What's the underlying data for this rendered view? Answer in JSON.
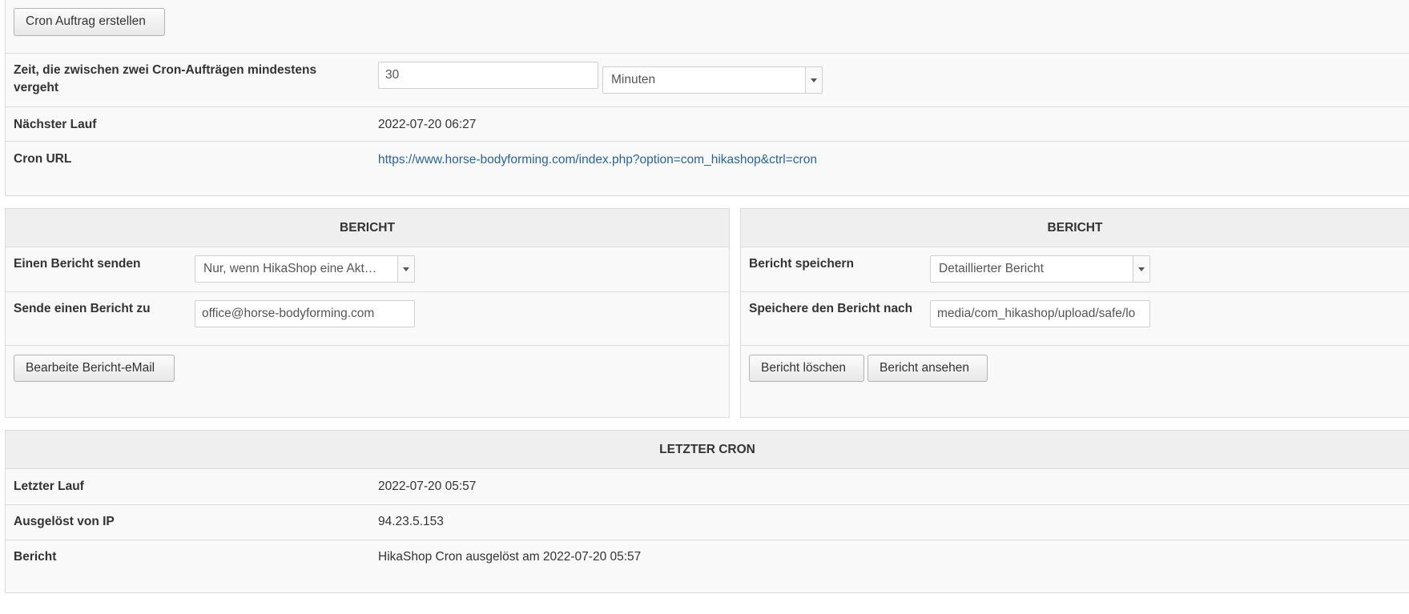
{
  "top": {
    "create_button": "Cron Auftrag erstellen",
    "interval_label": "Zeit, die zwischen zwei Cron-Aufträgen mindestens vergeht",
    "interval_value": "30",
    "interval_unit": "Minuten",
    "next_run_label": "Nächster Lauf",
    "next_run_value": "2022-07-20 06:27",
    "cron_url_label": "Cron URL",
    "cron_url_value": "https://www.horse-bodyforming.com/index.php?option=com_hikashop&ctrl=cron"
  },
  "report_send": {
    "header": "BERICHT",
    "send_label": "Einen Bericht senden",
    "send_value": "Nur, wenn HikaShop eine Akt…",
    "send_to_label": "Sende einen Bericht zu",
    "send_to_value": "office@horse-bodyforming.com",
    "edit_button": "Bearbeite Bericht-eMail"
  },
  "report_save": {
    "header": "BERICHT",
    "save_label": "Bericht speichern",
    "save_value": "Detaillierter Bericht",
    "save_to_label": "Speichere den Bericht nach",
    "save_to_value": "media/com_hikashop/upload/safe/lo",
    "delete_button": "Bericht löschen",
    "view_button": "Bericht ansehen"
  },
  "last_cron": {
    "header": "LETZTER CRON",
    "last_run_label": "Letzter Lauf",
    "last_run_value": "2022-07-20 05:57",
    "ip_label": "Ausgelöst von IP",
    "ip_value": "94.23.5.153",
    "report_label": "Bericht",
    "report_value": "HikaShop Cron ausgelöst am 2022-07-20 05:57"
  }
}
